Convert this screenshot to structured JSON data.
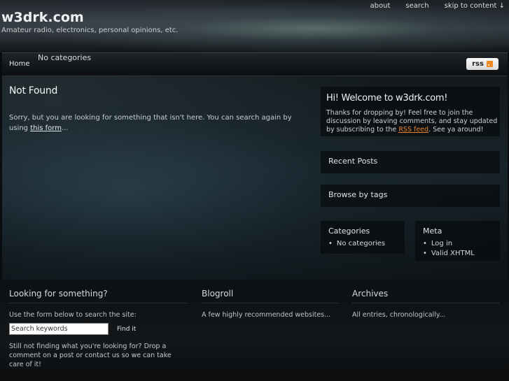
{
  "site": {
    "logo": "w3drk.com",
    "tagline": "Amateur radio, electronics, personal opinions, etc."
  },
  "topnav": [
    "about",
    "search",
    "skip to content ↓"
  ],
  "navbar": {
    "home": "Home",
    "categories": "No categories",
    "rss": "rss"
  },
  "content": {
    "title": "Not Found",
    "text_before": "Sorry, but you are looking for something that isn't here. You can search again by using ",
    "link": "this form",
    "text_after": "..."
  },
  "sidebar": {
    "welcome_title": "Hi! Welcome to w3drk.com!",
    "welcome_text_before": "Thanks for dropping by! Feel free to join the discussion by leaving comments, and stay updated by subscribing to the ",
    "welcome_link": "RSS feed",
    "welcome_text_after": ". See ya around!",
    "recent_posts": "Recent Posts",
    "browse_tags": "Browse by tags",
    "categories_title": "Categories",
    "categories_items": [
      "No categories"
    ],
    "meta_title": "Meta",
    "meta_items": [
      "Log in",
      "Valid XHTML"
    ]
  },
  "footer": {
    "search_title": "Looking for something?",
    "search_intro": "Use the form below to search the site:",
    "search_placeholder": "Search keywords",
    "search_value": "Search keywords",
    "find_button": "Find it",
    "search_note": "Still not finding what you're looking for? Drop a comment on a post or contact us so we can take care of it!",
    "blogroll_title": "Blogroll",
    "blogroll_text": "A few highly recommended websites...",
    "archives_title": "Archives",
    "archives_text": "All entries, chronologically..."
  },
  "colors": {
    "accent_link": "#e6832b",
    "rss_icon": "#f0891f"
  }
}
